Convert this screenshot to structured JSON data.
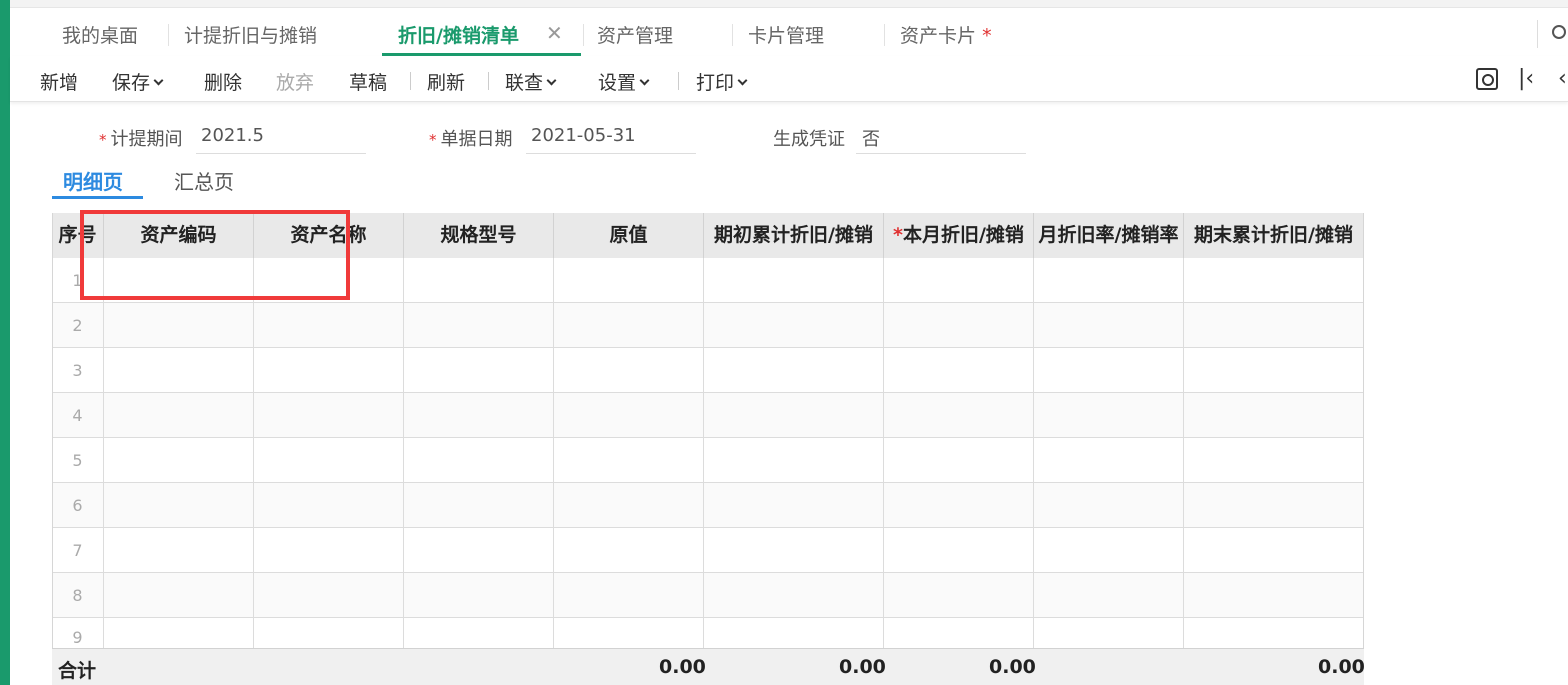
{
  "tabs": [
    {
      "label": "我的桌面"
    },
    {
      "label": "计提折旧与摊销"
    },
    {
      "label": "折旧/摊销清单",
      "active": true
    },
    {
      "label": "资产管理"
    },
    {
      "label": "卡片管理"
    },
    {
      "label": "资产卡片",
      "marker": "*"
    }
  ],
  "tab_close": "✕",
  "toolbar": {
    "add": "新增",
    "save": "保存",
    "delete": "删除",
    "discard": "放弃",
    "draft": "草稿",
    "refresh": "刷新",
    "link_query": "联查",
    "settings": "设置",
    "print": "打印",
    "first_glyph": "|‹",
    "prev_glyph": "‹"
  },
  "form": {
    "period_label": "计提期间",
    "period_value": "2021.5",
    "date_label": "单据日期",
    "date_value": "2021-05-31",
    "voucher_label": "生成凭证",
    "voucher_value": "否",
    "required_mark": "*"
  },
  "subtabs": [
    "明细页",
    "汇总页"
  ],
  "table": {
    "columns": [
      "序号",
      "资产编码",
      "资产名称",
      "规格型号",
      "原值",
      "期初累计折旧/摊销",
      "本月折旧/摊销",
      "月折旧率/摊销率",
      "期末累计折旧/摊销"
    ],
    "row_numbers": [
      "1",
      "2",
      "3",
      "4",
      "5",
      "6",
      "7",
      "8",
      "9"
    ],
    "total_label": "合计",
    "totals": {
      "original_value": "0.00",
      "opening_accum": "0.00",
      "current_month": "0.00",
      "closing_accum": "0.00"
    }
  },
  "colors": {
    "brand_green": "#1a9a6c",
    "active_blue": "#2c8ae0",
    "required_red": "#e03030",
    "highlight_red": "#f03a3a"
  },
  "icons": [
    "search-icon",
    "chevron-down-icon",
    "preview-icon",
    "first-page-icon",
    "prev-page-icon",
    "close-icon"
  ]
}
